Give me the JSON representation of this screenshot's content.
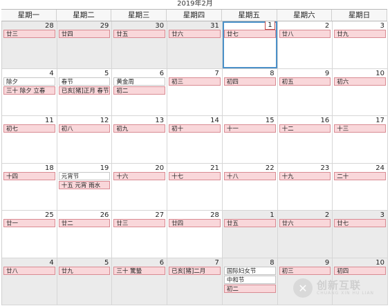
{
  "header": {
    "title": "2019年2月"
  },
  "weekdays": [
    "星期一",
    "星期二",
    "星期三",
    "星期四",
    "星期五",
    "星期六",
    "星期日"
  ],
  "weeks": [
    [
      {
        "day": "28",
        "other": true,
        "events": [
          {
            "text": "廿三",
            "style": "pink"
          }
        ]
      },
      {
        "day": "29",
        "other": true,
        "events": [
          {
            "text": "廿四",
            "style": "pink"
          }
        ]
      },
      {
        "day": "30",
        "other": true,
        "events": [
          {
            "text": "廿五",
            "style": "pink"
          }
        ]
      },
      {
        "day": "31",
        "other": true,
        "events": [
          {
            "text": "廿六",
            "style": "pink"
          }
        ]
      },
      {
        "day": "1",
        "today": true,
        "events": [
          {
            "text": "廿七",
            "style": "pink"
          }
        ]
      },
      {
        "day": "2",
        "events": [
          {
            "text": "廿八",
            "style": "pink"
          }
        ]
      },
      {
        "day": "3",
        "events": [
          {
            "text": "廿九",
            "style": "pink"
          }
        ]
      }
    ],
    [
      {
        "day": "4",
        "events": [
          {
            "text": "除夕",
            "style": "plain"
          },
          {
            "text": "三十 除夕 立春",
            "style": "pink"
          }
        ]
      },
      {
        "day": "5",
        "events": [
          {
            "text": "春节",
            "style": "plain"
          },
          {
            "text": "已亥[猪]正月 春节",
            "style": "pink"
          }
        ]
      },
      {
        "day": "6",
        "events": [
          {
            "text": "黄金周",
            "style": "plain"
          },
          {
            "text": "初二",
            "style": "pink"
          }
        ]
      },
      {
        "day": "7",
        "events": [
          {
            "text": "初三",
            "style": "pink"
          }
        ]
      },
      {
        "day": "8",
        "events": [
          {
            "text": "初四",
            "style": "pink"
          }
        ]
      },
      {
        "day": "9",
        "events": [
          {
            "text": "初五",
            "style": "pink"
          }
        ]
      },
      {
        "day": "10",
        "events": [
          {
            "text": "初六",
            "style": "pink"
          }
        ]
      }
    ],
    [
      {
        "day": "11",
        "events": [
          {
            "text": "初七",
            "style": "pink"
          }
        ]
      },
      {
        "day": "12",
        "events": [
          {
            "text": "初八",
            "style": "pink"
          }
        ]
      },
      {
        "day": "13",
        "events": [
          {
            "text": "初九",
            "style": "pink"
          }
        ]
      },
      {
        "day": "14",
        "events": [
          {
            "text": "初十",
            "style": "pink"
          }
        ]
      },
      {
        "day": "15",
        "events": [
          {
            "text": "十一",
            "style": "pink"
          }
        ]
      },
      {
        "day": "16",
        "events": [
          {
            "text": "十二",
            "style": "pink"
          }
        ]
      },
      {
        "day": "17",
        "events": [
          {
            "text": "十三",
            "style": "pink"
          }
        ]
      }
    ],
    [
      {
        "day": "18",
        "events": [
          {
            "text": "十四",
            "style": "pink"
          }
        ]
      },
      {
        "day": "19",
        "events": [
          {
            "text": "元宵节",
            "style": "plain"
          },
          {
            "text": "十五 元宵 雨水",
            "style": "pink"
          }
        ]
      },
      {
        "day": "20",
        "events": [
          {
            "text": "十六",
            "style": "pink"
          }
        ]
      },
      {
        "day": "21",
        "events": [
          {
            "text": "十七",
            "style": "pink"
          }
        ]
      },
      {
        "day": "22",
        "events": [
          {
            "text": "十八",
            "style": "pink"
          }
        ]
      },
      {
        "day": "23",
        "events": [
          {
            "text": "十九",
            "style": "pink"
          }
        ]
      },
      {
        "day": "24",
        "events": [
          {
            "text": "二十",
            "style": "pink"
          }
        ]
      }
    ],
    [
      {
        "day": "25",
        "events": [
          {
            "text": "廿一",
            "style": "pink"
          }
        ]
      },
      {
        "day": "26",
        "events": [
          {
            "text": "廿二",
            "style": "pink"
          }
        ]
      },
      {
        "day": "27",
        "events": [
          {
            "text": "廿三",
            "style": "pink"
          }
        ]
      },
      {
        "day": "28",
        "events": [
          {
            "text": "廿四",
            "style": "pink"
          }
        ]
      },
      {
        "day": "1",
        "other": true,
        "events": [
          {
            "text": "廿五",
            "style": "pink"
          }
        ]
      },
      {
        "day": "2",
        "other": true,
        "events": [
          {
            "text": "廿六",
            "style": "pink"
          }
        ]
      },
      {
        "day": "3",
        "other": true,
        "events": [
          {
            "text": "廿七",
            "style": "pink"
          }
        ]
      }
    ],
    [
      {
        "day": "4",
        "other": true,
        "events": [
          {
            "text": "廿八",
            "style": "pink"
          }
        ]
      },
      {
        "day": "5",
        "other": true,
        "events": [
          {
            "text": "廿九",
            "style": "pink"
          }
        ]
      },
      {
        "day": "6",
        "other": true,
        "events": [
          {
            "text": "三十 驚蟄",
            "style": "pink"
          }
        ]
      },
      {
        "day": "7",
        "other": true,
        "events": [
          {
            "text": "已亥[猪]二月",
            "style": "pink"
          }
        ]
      },
      {
        "day": "8",
        "other": true,
        "events": [
          {
            "text": "国际妇女节",
            "style": "plain"
          },
          {
            "text": "中和节",
            "style": "plain"
          },
          {
            "text": "初二",
            "style": "pink"
          }
        ]
      },
      {
        "day": "9",
        "other": true,
        "events": [
          {
            "text": "初三",
            "style": "pink"
          }
        ]
      },
      {
        "day": "10",
        "other": true,
        "events": [
          {
            "text": "初四",
            "style": "pink"
          }
        ]
      }
    ]
  ],
  "watermark": {
    "logo": "✕",
    "cn": "创新互联",
    "en": "CHUANG XIN HU LIAN"
  }
}
